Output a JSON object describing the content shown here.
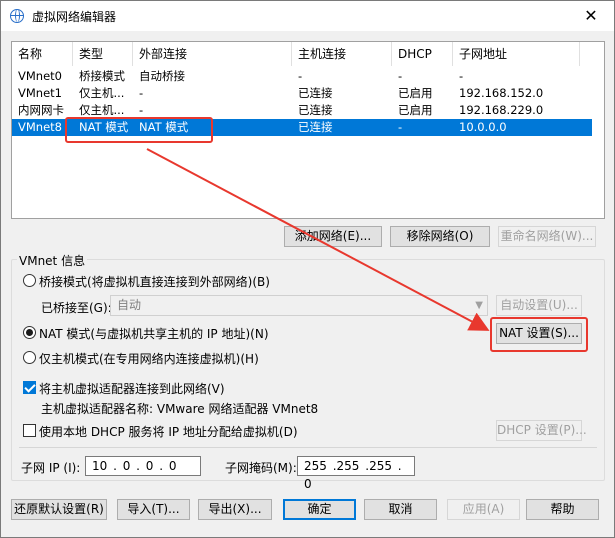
{
  "window": {
    "title": "虚拟网络编辑器",
    "close_glyph": "✕"
  },
  "netlist": {
    "columns": [
      "名称",
      "类型",
      "外部连接",
      "主机连接",
      "DHCP",
      "子网地址"
    ],
    "rows": [
      {
        "name": "VMnet0",
        "type": "桥接模式",
        "external": "自动桥接",
        "host": "-",
        "dhcp": "-",
        "subnet": "-"
      },
      {
        "name": "VMnet1",
        "type": "仅主机...",
        "external": "-",
        "host": "已连接",
        "dhcp": "已启用",
        "subnet": "192.168.152.0"
      },
      {
        "name": "内网网卡",
        "type": "仅主机...",
        "external": "-",
        "host": "已连接",
        "dhcp": "已启用",
        "subnet": "192.168.229.0"
      },
      {
        "name": "VMnet8",
        "type": "NAT 模式",
        "external": "NAT 模式",
        "host": "已连接",
        "dhcp": "-",
        "subnet": "10.0.0.0",
        "selected": true
      }
    ]
  },
  "list_buttons": {
    "add": "添加网络(E)...",
    "remove": "移除网络(O)",
    "rename": "重命名网络(W)..."
  },
  "vmnet_info": {
    "group_label": "VMnet 信息",
    "bridge_radio": "桥接模式(将虚拟机直接连接到外部网络)(B)",
    "bridged_to_label": "已桥接至(G):",
    "bridged_to_value": "自动",
    "auto_settings": "自动设置(U)...",
    "nat_radio": "NAT 模式(与虚拟机共享主机的 IP 地址)(N)",
    "nat_settings": "NAT 设置(S)...",
    "hostonly_radio": "仅主机模式(在专用网络内连接虚拟机)(H)",
    "connect_adapter": "将主机虚拟适配器连接到此网络(V)",
    "adapter_name": "主机虚拟适配器名称: VMware 网络适配器 VMnet8",
    "use_dhcp": "使用本地 DHCP 服务将 IP 地址分配给虚拟机(D)",
    "dhcp_settings": "DHCP 设置(P)...",
    "subnet_ip_label": "子网 IP (I):",
    "subnet_ip_value": "10 . 0 . 0 . 0",
    "subnet_mask_label": "子网掩码(M):",
    "subnet_mask_value": "255 .255 .255 . 0"
  },
  "footer_buttons": {
    "restore": "还原默认设置(R)",
    "import": "导入(T)...",
    "export": "导出(X)...",
    "ok": "确定",
    "cancel": "取消",
    "apply": "应用(A)",
    "help": "帮助"
  },
  "colors": {
    "selection": "#0078d7",
    "annotation": "#e8382e"
  }
}
